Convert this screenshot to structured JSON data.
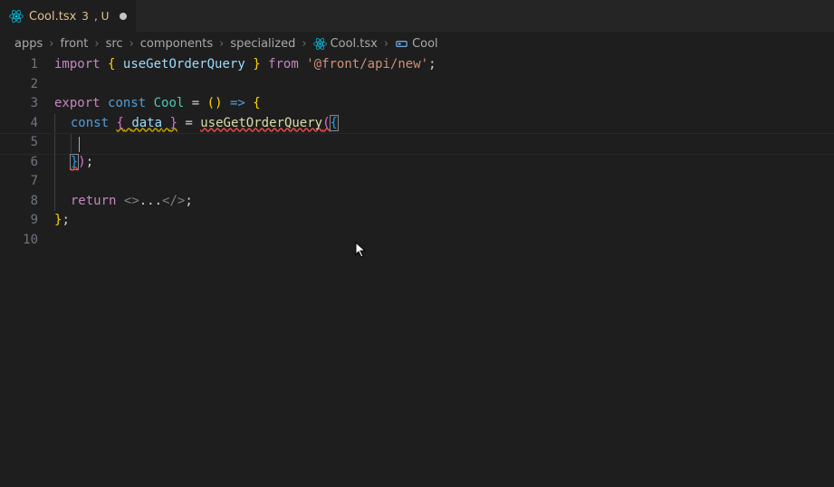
{
  "tab": {
    "filename": "Cool.tsx",
    "errorCount": "3",
    "gitStatus": ", U"
  },
  "breadcrumbs": {
    "parts": [
      "apps",
      "front",
      "src",
      "components",
      "specialized",
      "Cool.tsx"
    ],
    "symbol": "Cool"
  },
  "code": {
    "lineNumbers": [
      "1",
      "2",
      "3",
      "4",
      "5",
      "6",
      "7",
      "8",
      "9",
      "10"
    ],
    "l1": {
      "import": "import",
      "lbrace": "{",
      "sym": "useGetOrderQuery",
      "rbrace": "}",
      "from": "from",
      "path": "'@front/api/new'",
      "semi": ";"
    },
    "l3": {
      "export": "export",
      "const": "const",
      "name": "Cool",
      "eq": "=",
      "lpar": "(",
      "rpar": ")",
      "arrow": "=>",
      "lbrace": "{"
    },
    "l4": {
      "const": "const",
      "lbrace": "{",
      "data": "data",
      "rbrace": "}",
      "eq": "=",
      "call": "useGetOrderQuery",
      "lpar": "(",
      "obrace": "{"
    },
    "l6": {
      "cbrace": "}",
      "rpar": ")",
      "semi": ";"
    },
    "l8": {
      "return": "return",
      "lt": "<",
      "gt": ">",
      "dots": "...",
      "lts": "</",
      "gts": ">",
      "semi": ";"
    },
    "l9": {
      "rbrace": "}",
      "semi": ";"
    }
  }
}
